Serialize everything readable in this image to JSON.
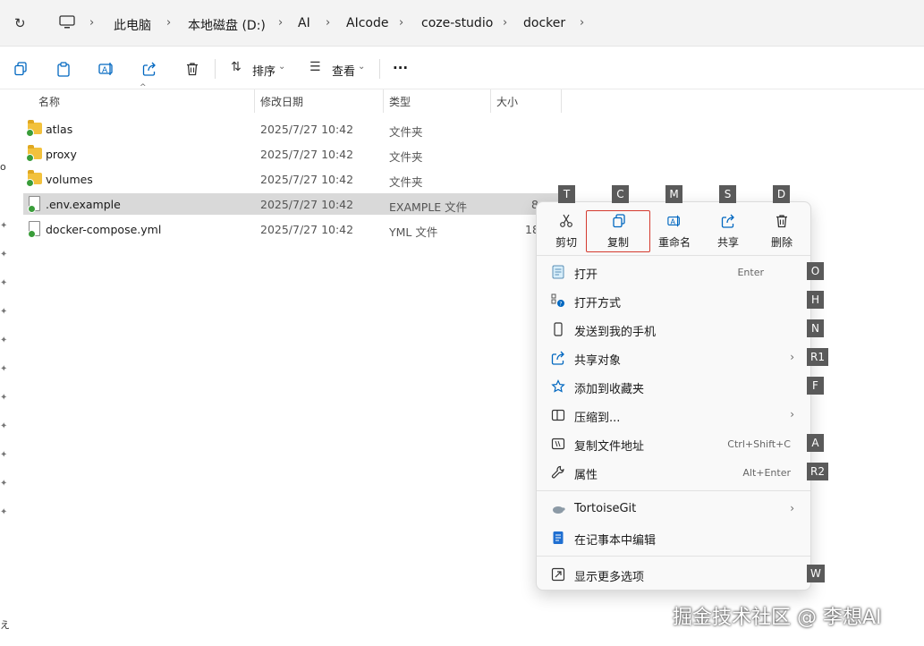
{
  "breadcrumb": [
    "此电脑",
    "本地磁盘 (D:)",
    "AI",
    "AIcode",
    "coze-studio",
    "docker"
  ],
  "toolbar": {
    "sort_label": "排序",
    "view_label": "查看",
    "more_label": "···"
  },
  "columns": {
    "name": "名称",
    "date": "修改日期",
    "type": "类型",
    "size": "大小"
  },
  "files": [
    {
      "name": "atlas",
      "date": "2025/7/27 10:42",
      "type": "文件夹",
      "size": ""
    },
    {
      "name": "proxy",
      "date": "2025/7/27 10:42",
      "type": "文件夹",
      "size": ""
    },
    {
      "name": "volumes",
      "date": "2025/7/27 10:42",
      "type": "文件夹",
      "size": ""
    },
    {
      "name": ".env.example",
      "date": "2025/7/27 10:42",
      "type": "EXAMPLE 文件",
      "size": "8"
    },
    {
      "name": "docker-compose.yml",
      "date": "2025/7/27 10:42",
      "type": "YML 文件",
      "size": "18"
    }
  ],
  "gutter": {
    "a": "o",
    "b": "え"
  },
  "quick_actions": [
    {
      "label": "剪切",
      "key": "T",
      "icon": "scissors-icon"
    },
    {
      "label": "复制",
      "key": "C",
      "icon": "copy-icon"
    },
    {
      "label": "重命名",
      "key": "M",
      "icon": "rename-icon"
    },
    {
      "label": "共享",
      "key": "S",
      "icon": "share-icon"
    },
    {
      "label": "删除",
      "key": "D",
      "icon": "trash-icon"
    }
  ],
  "menu_items": [
    {
      "label": "打开",
      "shortcut": "Enter",
      "key": "O"
    },
    {
      "label": "打开方式",
      "shortcut": "",
      "key": "H"
    },
    {
      "label": "发送到我的手机",
      "shortcut": "",
      "key": "N"
    },
    {
      "label": "共享对象",
      "shortcut": "",
      "key": "R1"
    },
    {
      "label": "添加到收藏夹",
      "shortcut": "",
      "key": "F"
    },
    {
      "label": "压缩到...",
      "shortcut": "",
      "key": ""
    },
    {
      "label": "复制文件地址",
      "shortcut": "Ctrl+Shift+C",
      "key": "A"
    },
    {
      "label": "属性",
      "shortcut": "Alt+Enter",
      "key": "R2"
    },
    {
      "label": "TortoiseGit",
      "shortcut": "",
      "key": ""
    },
    {
      "label": "在记事本中编辑",
      "shortcut": "",
      "key": ""
    },
    {
      "label": "显示更多选项",
      "shortcut": "",
      "key": "W"
    }
  ],
  "watermark": "掘金技术社区 @ 李想AI",
  "colors": {
    "accent": "#0067c0",
    "highlight_border": "#d43a2f",
    "selection": "#d9d9d9",
    "folder": "#f2c13c"
  }
}
